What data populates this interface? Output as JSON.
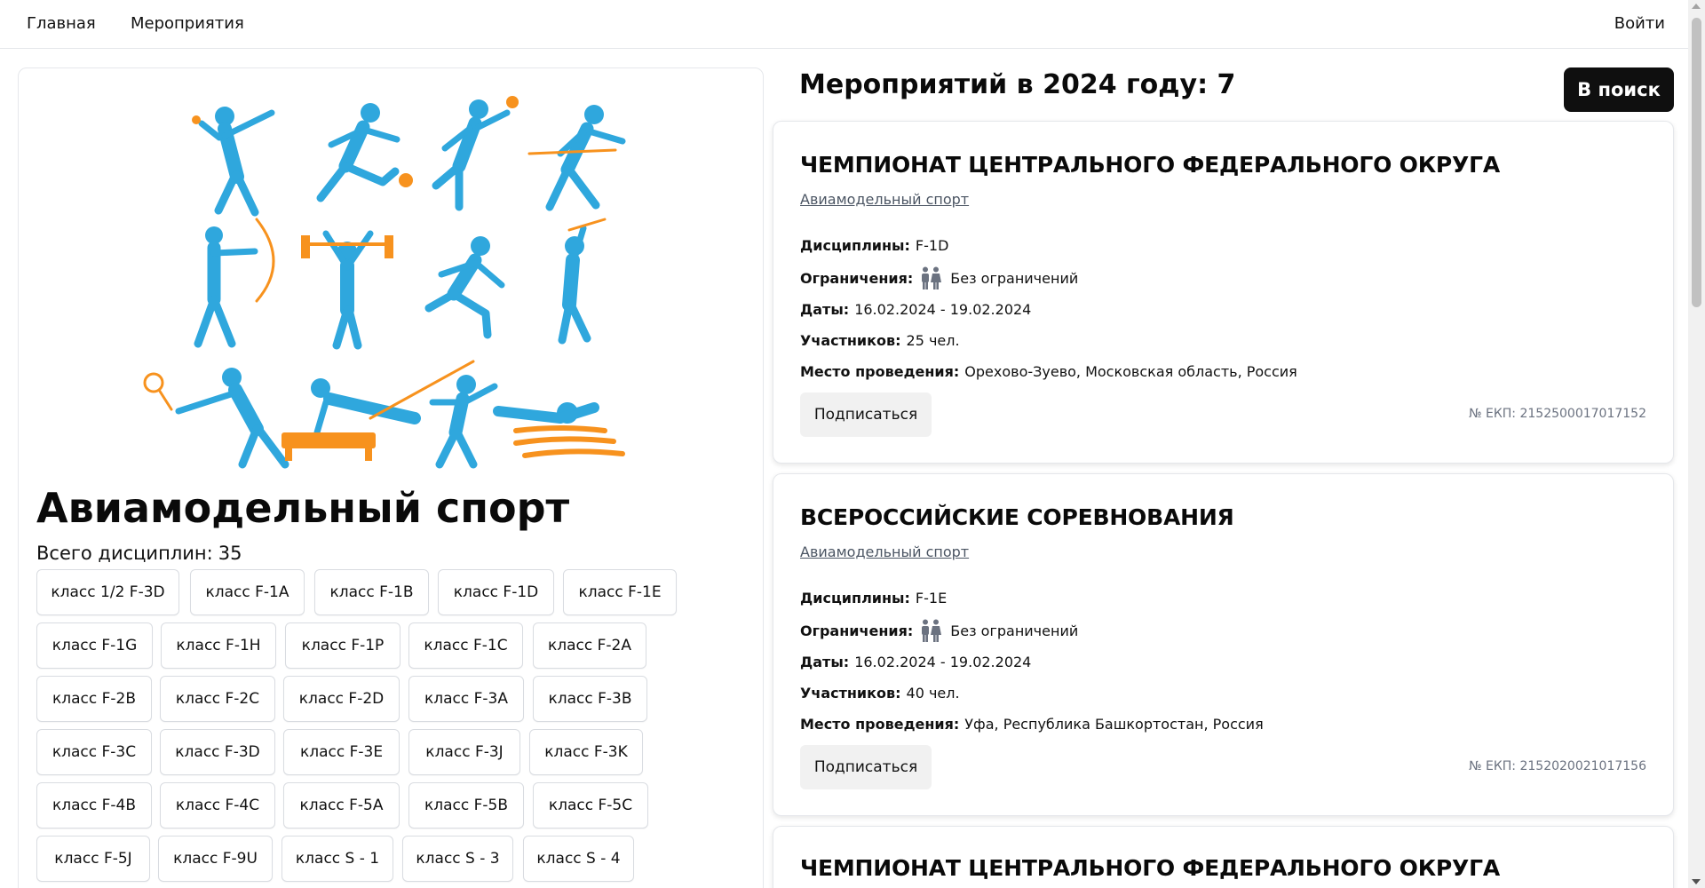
{
  "nav": {
    "home": "Главная",
    "events": "Мероприятия",
    "login": "Войти"
  },
  "sport": {
    "title": "Авиамодельный спорт",
    "disciplines_label": "Всего дисциплин:",
    "disciplines_count": "35",
    "disciplines": [
      [
        "класс 1/2 F-3D",
        "класс F-1A",
        "класс F-1B",
        "класс F-1D",
        "класс F-1E"
      ],
      [
        "класс F-1G",
        "класс F-1H",
        "класс F-1P",
        "класс F-1C",
        "класс F-2A"
      ],
      [
        "класс F-2B",
        "класс F-2C",
        "класс F-2D",
        "класс F-3A",
        "класс F-3B"
      ],
      [
        "класс F-3C",
        "класс F-3D",
        "класс F-3E",
        "класс F-3J",
        "класс F-3K"
      ],
      [
        "класс F-4B",
        "класс F-4C",
        "класс F-5A",
        "класс F-5B",
        "класс F-5C"
      ],
      [
        "класс F-5J",
        "класс F-9U",
        "класс S - 1",
        "класс S - 3",
        "класс S - 4"
      ]
    ],
    "illustration_colors": {
      "blue": "#2fa7dd",
      "orange": "#f7921e"
    }
  },
  "events": {
    "heading": "Мероприятий в 2024 году: 7",
    "search_button": "В поиск",
    "labels": {
      "disciplines": "Дисциплины:",
      "restrictions": "Ограничения:",
      "dates": "Даты:",
      "participants": "Участников:",
      "place": "Место проведения:",
      "subscribe": "Подписаться"
    },
    "items": [
      {
        "title": "ЧЕМПИОНАТ ЦЕНТРАЛЬНОГО ФЕДЕРАЛЬНОГО ОКРУГА",
        "sport": "Авиамодельный спорт",
        "disciplines": "F-1D",
        "restrictions": "Без ограничений",
        "dates": "16.02.2024 - 19.02.2024",
        "participants": "25 чел.",
        "place": "Орехово-Зуево, Московская область, Россия",
        "ekp": "№ ЕКП: 2152500017017152"
      },
      {
        "title": "ВСЕРОССИЙСКИЕ СОРЕВНОВАНИЯ",
        "sport": "Авиамодельный спорт",
        "disciplines": "F-1E",
        "restrictions": "Без ограничений",
        "dates": "16.02.2024 - 19.02.2024",
        "participants": "40 чел.",
        "place": "Уфа, Республика Башкортостан, Россия",
        "ekp": "№ ЕКП: 2152020021017156"
      },
      {
        "title": "ЧЕМПИОНАТ ЦЕНТРАЛЬНОГО ФЕДЕРАЛЬНОГО ОКРУГА"
      }
    ]
  }
}
